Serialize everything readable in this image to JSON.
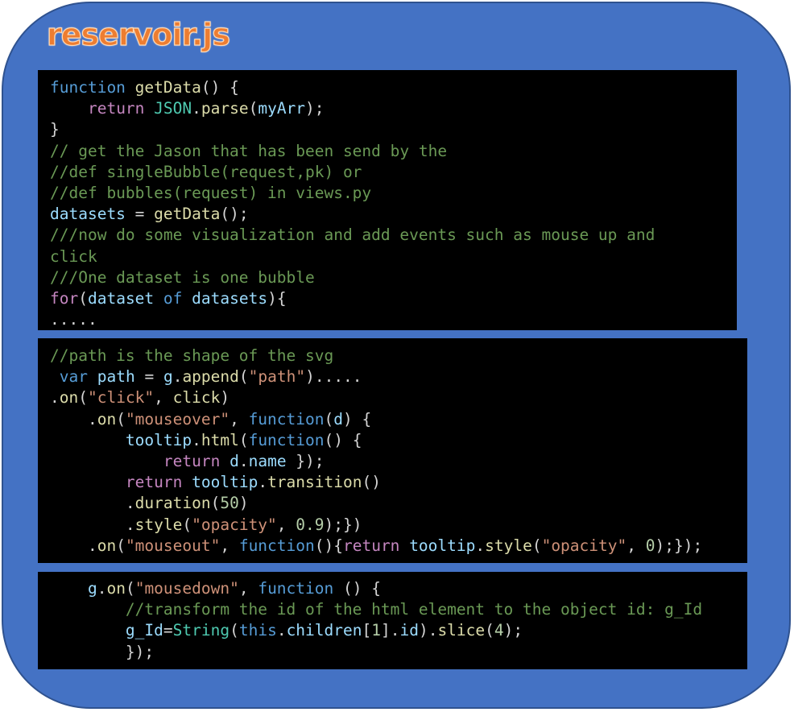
{
  "title": "reservoir.js",
  "colors": {
    "panel_fill": "#4472c4",
    "panel_border": "#2f528f",
    "title": "#ed7d31",
    "code_bg": "#000000",
    "keyword": "#569cd6",
    "control": "#c586c0",
    "function": "#dcdcaa",
    "variable": "#9cdcfe",
    "class": "#4ec9b0",
    "string": "#ce9178",
    "number": "#b5cea8",
    "comment": "#6a9955",
    "plain": "#d4d4d4"
  },
  "code_blocks": [
    {
      "lines": [
        [
          [
            "keyword",
            "function"
          ],
          [
            "plain",
            " "
          ],
          [
            "function",
            "getData"
          ],
          [
            "plain",
            "() {"
          ]
        ],
        [
          [
            "plain",
            "    "
          ],
          [
            "control",
            "return"
          ],
          [
            "plain",
            " "
          ],
          [
            "class",
            "JSON"
          ],
          [
            "plain",
            "."
          ],
          [
            "function",
            "parse"
          ],
          [
            "plain",
            "("
          ],
          [
            "variable",
            "myArr"
          ],
          [
            "plain",
            ");"
          ]
        ],
        [
          [
            "plain",
            "}"
          ]
        ],
        [
          [
            "comment",
            "// get the Jason that has been send by the"
          ]
        ],
        [
          [
            "comment",
            "//def singleBubble(request,pk) or"
          ]
        ],
        [
          [
            "comment",
            "//def bubbles(request) in views.py"
          ]
        ],
        [
          [
            "variable",
            "datasets"
          ],
          [
            "plain",
            " = "
          ],
          [
            "function",
            "getData"
          ],
          [
            "plain",
            "();"
          ]
        ],
        [
          [
            "comment",
            "///now do some visualization and add events such as mouse up and"
          ]
        ],
        [
          [
            "comment",
            "click"
          ]
        ],
        [
          [
            "comment",
            "///One dataset is one bubble"
          ]
        ],
        [
          [
            "control",
            "for"
          ],
          [
            "plain",
            "("
          ],
          [
            "variable",
            "dataset"
          ],
          [
            "plain",
            " "
          ],
          [
            "keyword",
            "of"
          ],
          [
            "plain",
            " "
          ],
          [
            "variable",
            "datasets"
          ],
          [
            "plain",
            "){"
          ]
        ],
        [
          [
            "plain",
            "....."
          ]
        ]
      ]
    },
    {
      "lines": [
        [
          [
            "comment",
            "//path is the shape of the svg"
          ]
        ],
        [
          [
            "plain",
            " "
          ],
          [
            "keyword",
            "var"
          ],
          [
            "plain",
            " "
          ],
          [
            "variable",
            "path"
          ],
          [
            "plain",
            " = "
          ],
          [
            "variable",
            "g"
          ],
          [
            "plain",
            "."
          ],
          [
            "function",
            "append"
          ],
          [
            "plain",
            "("
          ],
          [
            "string",
            "\"path\""
          ],
          [
            "plain",
            ")....."
          ]
        ],
        [
          [
            "plain",
            "."
          ],
          [
            "function",
            "on"
          ],
          [
            "plain",
            "("
          ],
          [
            "string",
            "\"click\""
          ],
          [
            "plain",
            ", "
          ],
          [
            "function",
            "click"
          ],
          [
            "plain",
            ")"
          ]
        ],
        [
          [
            "plain",
            "    ."
          ],
          [
            "function",
            "on"
          ],
          [
            "plain",
            "("
          ],
          [
            "string",
            "\"mouseover\""
          ],
          [
            "plain",
            ", "
          ],
          [
            "keyword",
            "function"
          ],
          [
            "plain",
            "("
          ],
          [
            "variable",
            "d"
          ],
          [
            "plain",
            ") {"
          ]
        ],
        [
          [
            "plain",
            "        "
          ],
          [
            "variable",
            "tooltip"
          ],
          [
            "plain",
            "."
          ],
          [
            "function",
            "html"
          ],
          [
            "plain",
            "("
          ],
          [
            "keyword",
            "function"
          ],
          [
            "plain",
            "() {"
          ]
        ],
        [
          [
            "plain",
            "            "
          ],
          [
            "control",
            "return"
          ],
          [
            "plain",
            " "
          ],
          [
            "variable",
            "d"
          ],
          [
            "plain",
            "."
          ],
          [
            "variable",
            "name"
          ],
          [
            "plain",
            " });"
          ]
        ],
        [
          [
            "plain",
            "        "
          ],
          [
            "control",
            "return"
          ],
          [
            "plain",
            " "
          ],
          [
            "variable",
            "tooltip"
          ],
          [
            "plain",
            "."
          ],
          [
            "function",
            "transition"
          ],
          [
            "plain",
            "()"
          ]
        ],
        [
          [
            "plain",
            "        ."
          ],
          [
            "function",
            "duration"
          ],
          [
            "plain",
            "("
          ],
          [
            "number",
            "50"
          ],
          [
            "plain",
            ")"
          ]
        ],
        [
          [
            "plain",
            "        ."
          ],
          [
            "function",
            "style"
          ],
          [
            "plain",
            "("
          ],
          [
            "string",
            "\"opacity\""
          ],
          [
            "plain",
            ", "
          ],
          [
            "number",
            "0.9"
          ],
          [
            "plain",
            ");})"
          ]
        ],
        [
          [
            "plain",
            "    ."
          ],
          [
            "function",
            "on"
          ],
          [
            "plain",
            "("
          ],
          [
            "string",
            "\"mouseout\""
          ],
          [
            "plain",
            ", "
          ],
          [
            "keyword",
            "function"
          ],
          [
            "plain",
            "(){"
          ],
          [
            "control",
            "return"
          ],
          [
            "plain",
            " "
          ],
          [
            "variable",
            "tooltip"
          ],
          [
            "plain",
            "."
          ],
          [
            "function",
            "style"
          ],
          [
            "plain",
            "("
          ],
          [
            "string",
            "\"opacity\""
          ],
          [
            "plain",
            ", "
          ],
          [
            "number",
            "0"
          ],
          [
            "plain",
            ");});"
          ]
        ]
      ]
    },
    {
      "lines": [
        [
          [
            "plain",
            "    "
          ],
          [
            "variable",
            "g"
          ],
          [
            "plain",
            "."
          ],
          [
            "function",
            "on"
          ],
          [
            "plain",
            "("
          ],
          [
            "string",
            "\"mousedown\""
          ],
          [
            "plain",
            ", "
          ],
          [
            "keyword",
            "function"
          ],
          [
            "plain",
            " () {"
          ]
        ],
        [
          [
            "plain",
            "        "
          ],
          [
            "comment",
            "//transform the id of the html element to the object id: g_Id"
          ]
        ],
        [
          [
            "plain",
            "        "
          ],
          [
            "variable",
            "g_Id"
          ],
          [
            "plain",
            "="
          ],
          [
            "class",
            "String"
          ],
          [
            "plain",
            "("
          ],
          [
            "keyword",
            "this"
          ],
          [
            "plain",
            "."
          ],
          [
            "variable",
            "children"
          ],
          [
            "plain",
            "["
          ],
          [
            "number",
            "1"
          ],
          [
            "plain",
            "]."
          ],
          [
            "variable",
            "id"
          ],
          [
            "plain",
            ")."
          ],
          [
            "function",
            "slice"
          ],
          [
            "plain",
            "("
          ],
          [
            "number",
            "4"
          ],
          [
            "plain",
            ");"
          ]
        ],
        [
          [
            "plain",
            "        });"
          ]
        ]
      ]
    }
  ]
}
